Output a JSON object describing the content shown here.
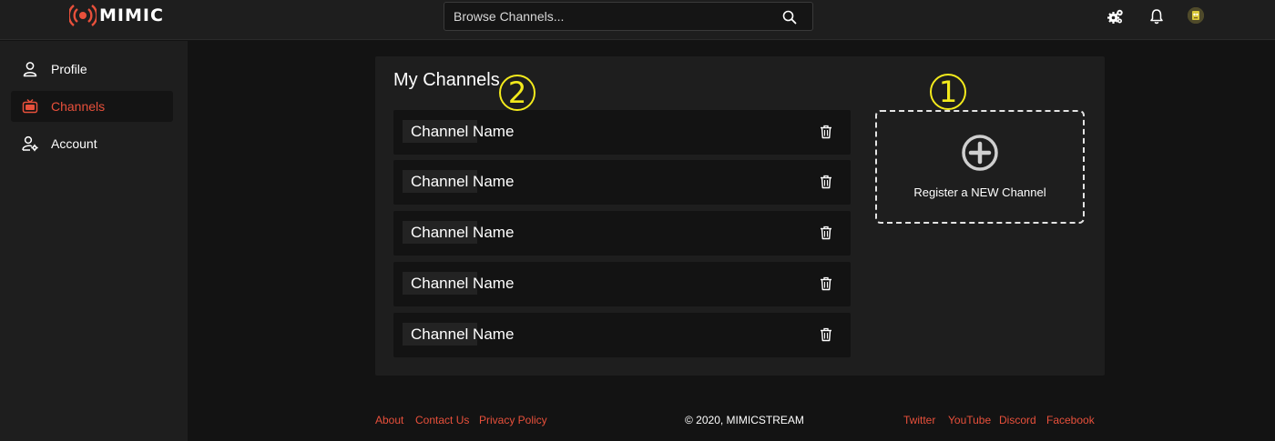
{
  "app": {
    "brand": "MIMIC",
    "accent_color": "#e8503b",
    "callout_color": "#f3ea1c"
  },
  "search": {
    "placeholder": "Browse Channels..."
  },
  "header_icons": [
    "gears-icon",
    "bell-icon",
    "avatar"
  ],
  "sidebar": {
    "items": [
      {
        "label": "Profile",
        "icon": "user-icon",
        "active": false
      },
      {
        "label": "Channels",
        "icon": "tv-icon",
        "active": true
      },
      {
        "label": "Account",
        "icon": "user-gear-icon",
        "active": false
      }
    ]
  },
  "channels": {
    "title": "My Channels",
    "items": [
      {
        "name": "Channel Name"
      },
      {
        "name": "Channel Name"
      },
      {
        "name": "Channel Name"
      },
      {
        "name": "Channel Name"
      },
      {
        "name": "Channel Name"
      }
    ],
    "register_label": "Register a NEW Channel"
  },
  "callouts": {
    "register": "1",
    "channels": "2"
  },
  "footer": {
    "left_links": [
      "About",
      "Contact Us",
      "Privacy Policy"
    ],
    "copyright": "© 2020, MIMICSTREAM",
    "right_links": [
      "Twitter",
      "YouTube",
      "Discord",
      "Facebook"
    ]
  }
}
